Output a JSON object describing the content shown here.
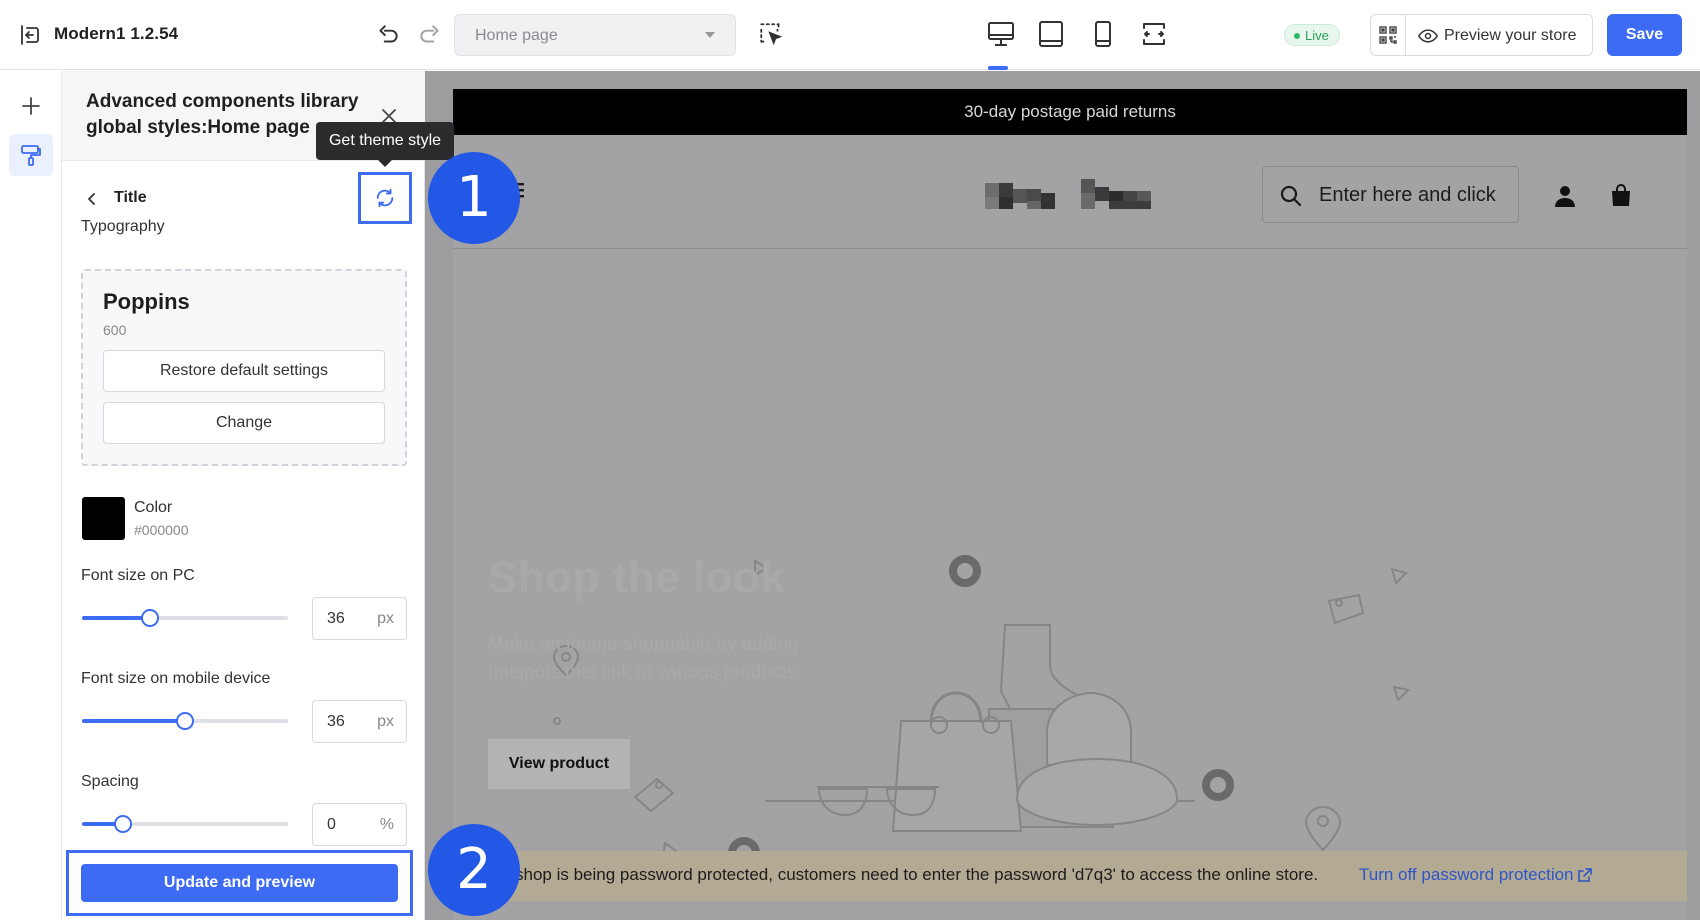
{
  "topbar": {
    "app_title": "Modern1 1.2.54",
    "page_select": "Home page",
    "live_label": "Live",
    "preview_label": "Preview your store",
    "save_label": "Save"
  },
  "panel": {
    "header_title": "Advanced components library global styles:Home page",
    "back_label": "Title",
    "tooltip": "Get theme style",
    "typography_label": "Typography",
    "font_name": "Poppins",
    "font_weight": "600",
    "restore_label": "Restore default settings",
    "change_label": "Change",
    "color_label": "Color",
    "color_hex": "#000000",
    "font_pc_label": "Font size on PC",
    "font_pc_value": "36",
    "font_pc_unit": "px",
    "font_pc_slider": 0.33,
    "font_mobile_label": "Font size on mobile device",
    "font_mobile_value": "36",
    "font_mobile_unit": "px",
    "font_mobile_slider": 0.5,
    "spacing_label": "Spacing",
    "spacing_value": "0",
    "spacing_unit": "%",
    "spacing_slider": 0.2,
    "update_label": "Update and preview"
  },
  "preview": {
    "announcement": "30-day postage paid returns",
    "search_placeholder": "Enter here and click",
    "hero_title": "Shop the look",
    "hero_subtitle": "Make an image shoppable by adding hotspots that link to various products.",
    "view_product_label": "View product",
    "password_message": "shop is being password protected, customers need to enter the password 'd7q3' to access the online store.",
    "password_link": "Turn off password protection"
  },
  "steps": {
    "step1": "1",
    "step2": "2"
  },
  "colors": {
    "accent": "#3d6bf3",
    "step_badge": "#2357e6",
    "live": "#2fb866"
  }
}
